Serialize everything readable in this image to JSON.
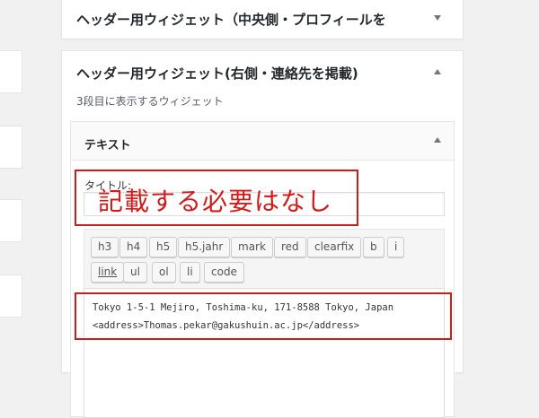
{
  "left_boxes": [
    {
      "id": "box1"
    },
    {
      "id": "box2"
    }
  ],
  "panel_top": {
    "title": "ヘッダー用ウィジェット（中央側・プロフィールを",
    "arrow": "down"
  },
  "panel_main": {
    "title": "ヘッダー用ウィジェット(右側・連絡先を掲載)",
    "arrow": "up",
    "description": "3段目に表示するウィジェット",
    "widget": {
      "title": "テキスト",
      "arrow": "up",
      "field_label": "タイトル:",
      "title_value": "",
      "quicktags": [
        "h3",
        "h4",
        "h5",
        "h5.jahr",
        "mark",
        "red",
        "clearfix",
        "b",
        "i",
        "link",
        "ul",
        "ol",
        "li",
        "code"
      ],
      "content_lines": [
        "Tokyo 1-5-1 Mejiro, Toshima-ku, 171-8588 Tokyo, Japan",
        "<address>Thomas.pekar@gakushuin.ac.jp</address>"
      ]
    }
  },
  "annotation": {
    "text": "記載する必要はなし",
    "color": "#d11a1a"
  }
}
